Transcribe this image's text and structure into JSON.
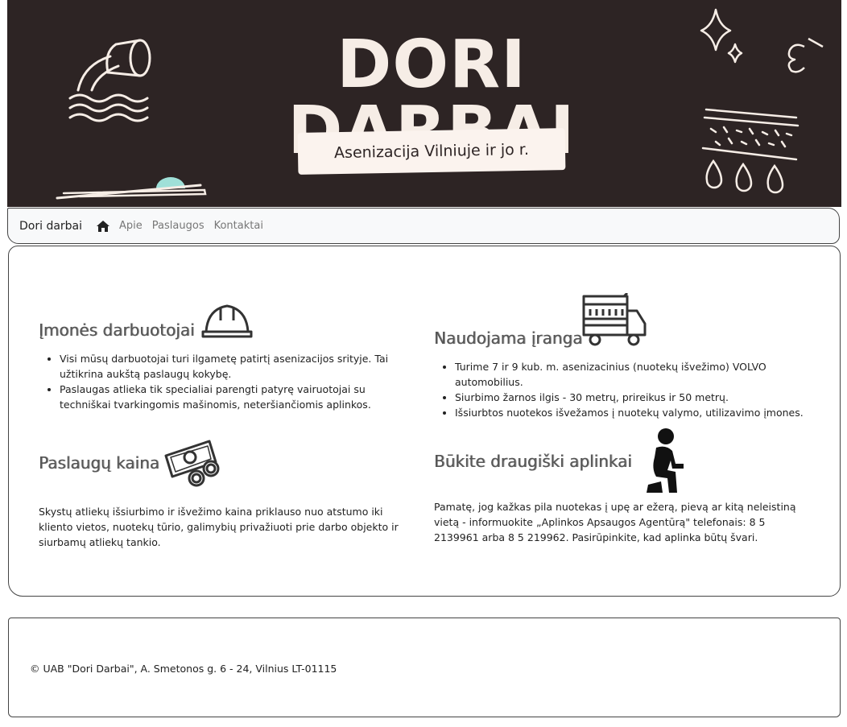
{
  "banner": {
    "title": "DORI DARBAI",
    "subtitle": "Asenizacija Vilniuje ir jo r."
  },
  "navbar": {
    "brand": "Dori darbai",
    "links": [
      "Apie",
      "Paslaugos",
      "Kontaktai"
    ]
  },
  "sections": {
    "employees": {
      "title": "Įmonės darbuotojai",
      "items": [
        "Visi mūsų darbuotojai turi ilgametę patirtį asenizacijos srityje. Tai užtikrina aukštą paslaugų kokybę.",
        "Paslaugas atlieka tik specialiai parengti patyrę vairuotojai su techniškai tvarkingomis mašinomis, neteršiančiomis aplinkos."
      ]
    },
    "equipment": {
      "title": "Naudojama įranga",
      "items": [
        "Turime 7 ir 9 kub. m. asenizacinius (nuotekų išvežimo) VOLVO automobilius.",
        "Siurbimo žarnos ilgis - 30 metrų, prireikus ir 50 metrų.",
        "Išsiurbtos nuotekos išvežamos į nuotekų valymo, utilizavimo įmones."
      ]
    },
    "price": {
      "title": "Paslaugų kaina",
      "text": "Skystų atliekų išsiurbimo ir išvežimo kaina priklauso nuo atstumo iki kliento vietos, nuotekų tūrio, galimybių privažiuoti prie darbo objekto ir siurbamų atliekų tankio."
    },
    "eco": {
      "title": "Būkite draugiški aplinkai",
      "text": "Pamatę, jog kažkas pila nuotekas į upę ar ežerą, pievą ar kitą neleistiną vietą - informuokite „Aplinkos Apsaugos Agentūrą\" telefonais: 8 5 2139961 arba 8 5 219962. Pasirūpinkite, kad aplinka būtų švari."
    }
  },
  "footer": {
    "text": "© UAB \"Dori Darbai\", A. Smetonos g. 6 - 24, Vilnius LT-01115"
  },
  "colors": {
    "banner_bg": "#2d2424",
    "banner_text": "#f6ede6",
    "accent_mint": "#9fe0d8"
  }
}
